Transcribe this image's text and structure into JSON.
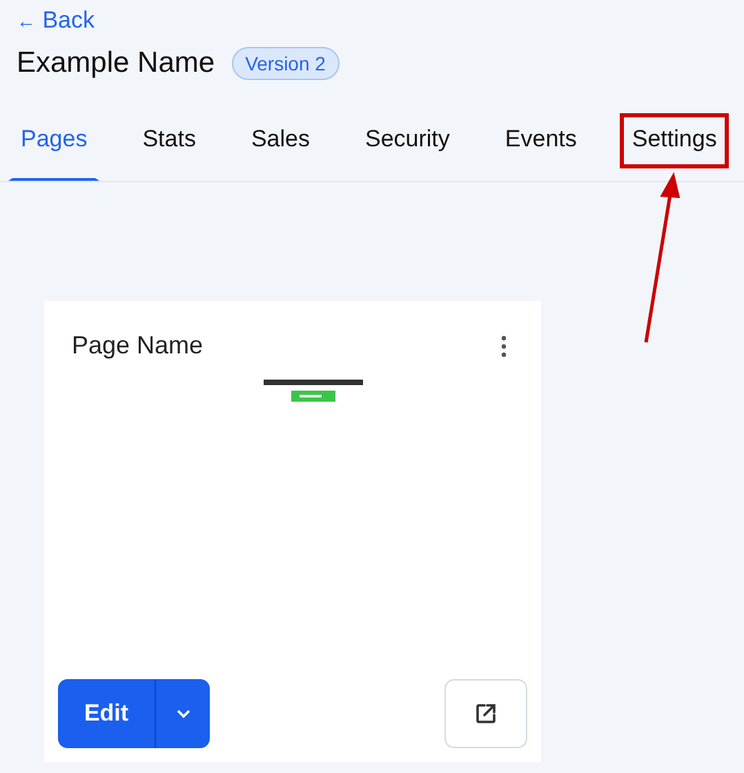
{
  "back_link": {
    "icon": "←",
    "label": "Back"
  },
  "header": {
    "title": "Example Name",
    "version_badge": "Version 2"
  },
  "tabs": [
    {
      "label": "Pages",
      "selected": true,
      "highlighted": false
    },
    {
      "label": "Stats",
      "selected": false,
      "highlighted": false
    },
    {
      "label": "Sales",
      "selected": false,
      "highlighted": false
    },
    {
      "label": "Security",
      "selected": false,
      "highlighted": false
    },
    {
      "label": "Events",
      "selected": false,
      "highlighted": false
    },
    {
      "label": "Settings",
      "selected": false,
      "highlighted": true
    }
  ],
  "page_card": {
    "name": "Page Name",
    "edit_button": "Edit"
  }
}
